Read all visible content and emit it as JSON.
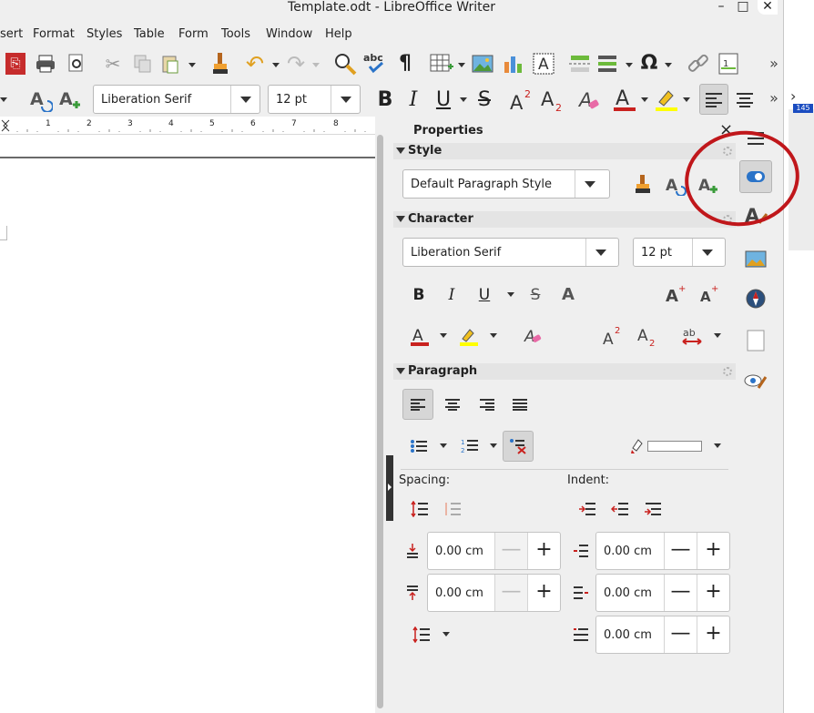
{
  "window": {
    "title": "Template.odt - LibreOffice Writer",
    "minimize": "–",
    "maximize": "□",
    "close": "✕"
  },
  "menu": [
    "sert",
    "Format",
    "Styles",
    "Table",
    "Form",
    "Tools",
    "Window",
    "Help"
  ],
  "toolbar2": {
    "font_name": "Liberation Serif",
    "font_size": "12 pt"
  },
  "ruler": {
    "ticks": [
      "1",
      "2",
      "3",
      "4",
      "5",
      "6",
      "7",
      "8"
    ]
  },
  "external": {
    "badge": "145"
  },
  "sidebar": {
    "title": "Properties",
    "close": "×",
    "style": {
      "header": "Style",
      "paragraph_style": "Default Paragraph Style"
    },
    "character": {
      "header": "Character",
      "font_name": "Liberation Serif",
      "font_size": "12 pt"
    },
    "paragraph": {
      "header": "Paragraph",
      "spacing_label": "Spacing:",
      "indent_label": "Indent:",
      "above_spacing": "0.00 cm",
      "below_spacing": "0.00 cm",
      "before_indent": "0.00 cm",
      "after_indent": "0.00 cm",
      "first_line_indent": "0.00 cm",
      "minus": "—",
      "plus": "+"
    }
  },
  "colors": {
    "font_color": "#c9211e",
    "highlight_color": "#ffff00",
    "annotation_circle": "#c0171b",
    "active_bg": "#d6d6d6"
  },
  "icons": {
    "deck": [
      "hamburger-menu-icon",
      "properties-icon",
      "styles-icon",
      "gallery-icon",
      "navigator-icon",
      "page-icon",
      "style-inspector-icon"
    ]
  }
}
